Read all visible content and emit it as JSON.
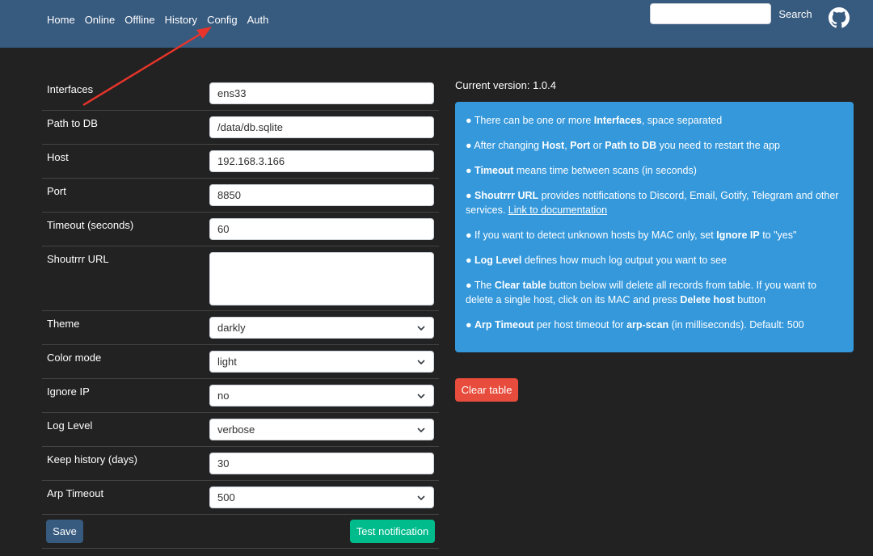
{
  "nav": {
    "items": [
      "Home",
      "Online",
      "Offline",
      "History",
      "Config",
      "Auth"
    ],
    "search_placeholder": "",
    "search_button": "Search"
  },
  "form": {
    "fields": [
      {
        "label": "Interfaces",
        "type": "text",
        "value": "ens33"
      },
      {
        "label": "Path to DB",
        "type": "text",
        "value": "/data/db.sqlite"
      },
      {
        "label": "Host",
        "type": "text",
        "value": "192.168.3.166"
      },
      {
        "label": "Port",
        "type": "text",
        "value": "8850"
      },
      {
        "label": "Timeout (seconds)",
        "type": "text",
        "value": "60"
      },
      {
        "label": "Shoutrrr URL",
        "type": "textarea",
        "value": ""
      },
      {
        "label": "Theme",
        "type": "select",
        "value": "darkly"
      },
      {
        "label": "Color mode",
        "type": "select",
        "value": "light"
      },
      {
        "label": "Ignore IP",
        "type": "select",
        "value": "no"
      },
      {
        "label": "Log Level",
        "type": "select",
        "value": "verbose"
      },
      {
        "label": "Keep history (days)",
        "type": "text",
        "value": "30"
      },
      {
        "label": "Arp Timeout",
        "type": "select",
        "value": "500"
      }
    ],
    "save_label": "Save",
    "test_label": "Test notification"
  },
  "version_text": "Current version: 1.0.4",
  "info": {
    "interfaces": {
      "pre": "● There can be one or more ",
      "b1": "Interfaces",
      "post": ", space separated"
    },
    "restart": {
      "pre": "● After changing ",
      "b1": "Host",
      "m1": ", ",
      "b2": "Port",
      "m2": " or ",
      "b3": "Path to DB",
      "post": " you need to restart the app"
    },
    "timeout": {
      "pre": "● ",
      "b1": "Timeout",
      "post": " means time between scans (in seconds)"
    },
    "shoutrrr": {
      "pre": "● ",
      "b1": "Shoutrrr URL",
      "post": " provides notifications to Discord, Email, Gotify, Telegram and other services. ",
      "link": "Link to documentation"
    },
    "ignore_ip": {
      "pre": "● If you want to detect unknown hosts by MAC only, set ",
      "b1": "Ignore IP",
      "post": " to \"yes\""
    },
    "log_level": {
      "pre": "● ",
      "b1": "Log Level",
      "post": " defines how much log output you want to see"
    },
    "clear": {
      "pre": "● The ",
      "b1": "Clear table",
      "m1": " button below will delete all records from table. If you want to delete a single host, click on its MAC and press ",
      "b2": "Delete host",
      "post": " button"
    },
    "arp": {
      "pre": "● ",
      "b1": "Arp Timeout",
      "m1": " per host timeout for ",
      "b2": "arp-scan",
      "post": " (in milliseconds). Default: 500"
    }
  },
  "clear_label": "Clear table",
  "colors": {
    "navbar": "#375a7f",
    "background": "#222222",
    "info": "#3498db",
    "success": "#00bc8c",
    "danger": "#e74c3c",
    "annotation_arrow": "#e8342a"
  },
  "icons": [
    "github-icon",
    "chevron-down-icon"
  ]
}
